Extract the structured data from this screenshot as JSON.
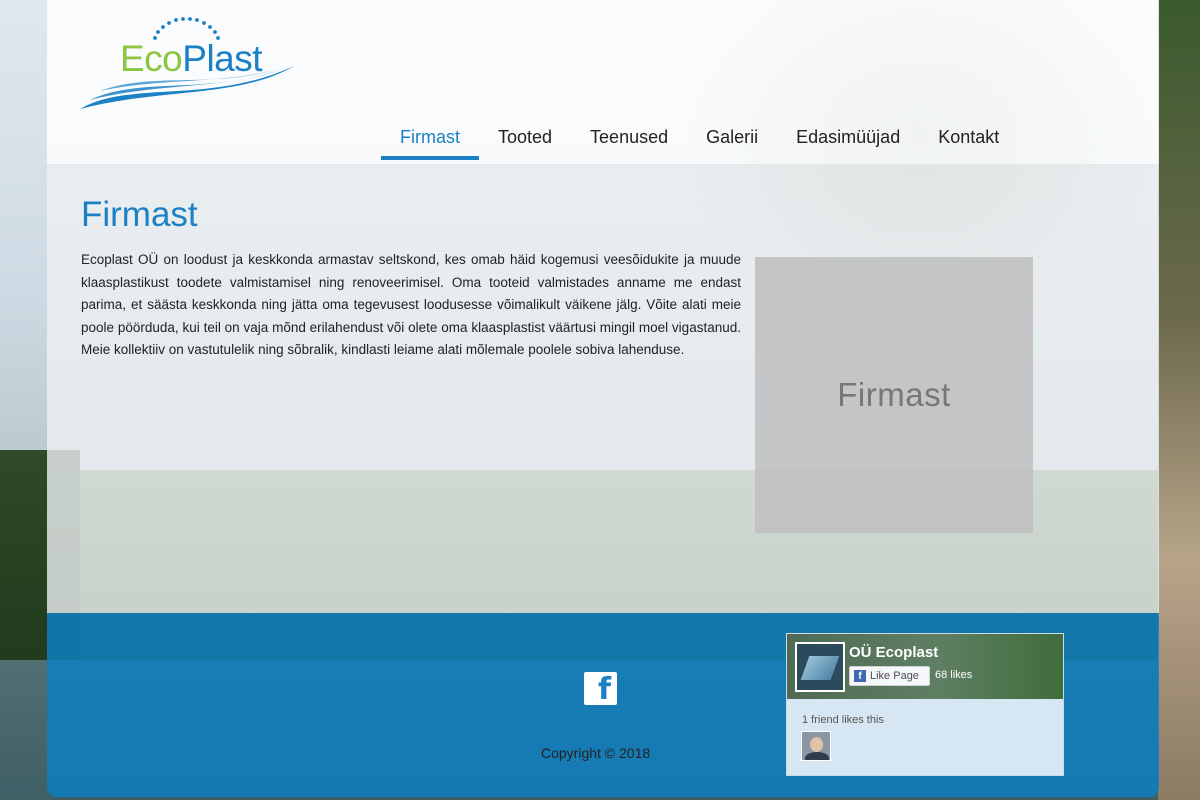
{
  "brand": {
    "logo_eco": "Eco",
    "logo_plast": "Plast",
    "colors": {
      "blue": "#1b80c4",
      "green": "#8cc63e"
    }
  },
  "nav": {
    "items": [
      {
        "label": "Firmast",
        "active": true
      },
      {
        "label": "Tooted",
        "active": false
      },
      {
        "label": "Teenused",
        "active": false
      },
      {
        "label": "Galerii",
        "active": false
      },
      {
        "label": "Edasimüüjad",
        "active": false
      },
      {
        "label": "Kontakt",
        "active": false
      }
    ]
  },
  "main": {
    "title": "Firmast",
    "body": "Ecoplast OÜ on loodust ja keskkonda armastav seltskond, kes omab häid kogemusi veesõidukite ja muude klaasplastikust toodete valmistamisel ning renoveerimisel. Oma tooteid valmistades anname me endast parima, et säästa keskkonda ning jätta oma tegevusest loodusesse võimalikult väikene jälg. Võite alati meie poole pöörduda, kui teil on vaja mõnd erilahendust või olete oma klaasplastist väärtusi mingil moel vigastanud. Meie kollektiiv on vastutulelik ning sõbralik, kindlasti leiame alati mõlemale poolele sobiva lahenduse.",
    "image_placeholder": "Firmast"
  },
  "footer": {
    "facebook_icon": "facebook-icon",
    "copyright": "Copyright © 2018",
    "fb_widget": {
      "page_name": "OÜ Ecoplast",
      "like_button": "Like Page",
      "likes": "68 likes",
      "friends_text": "1 friend likes this"
    }
  }
}
